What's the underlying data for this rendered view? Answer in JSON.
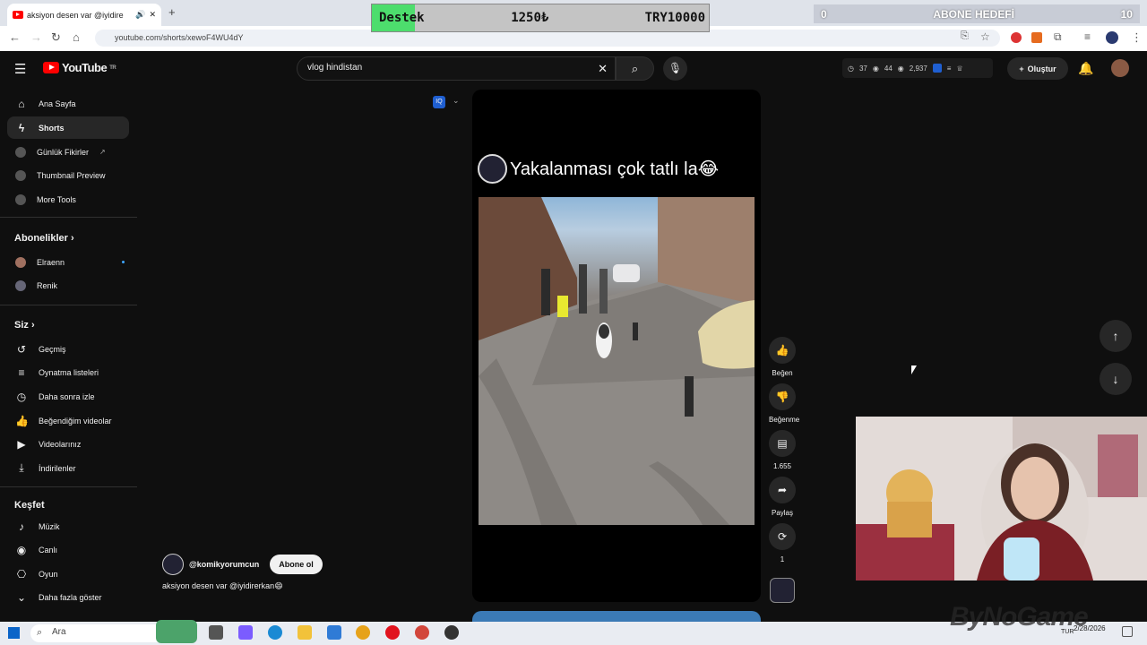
{
  "browser": {
    "tab_title": "aksiyon desen var @iyidire",
    "url": "youtube.com/shorts/xewoF4WU4dY"
  },
  "overlay": {
    "destek_label": "Destek",
    "destek_current": "1250₺",
    "destek_goal": "TRY10000",
    "abone_left": "0",
    "abone_title": "ABONE HEDEFİ",
    "abone_right": "10",
    "watermark": "ByNoGame"
  },
  "youtube": {
    "search_value": "vlog hindistan",
    "stats": {
      "a": "37",
      "b": "44",
      "c": "2,937"
    },
    "create_label": "Oluştur",
    "logo_text": "YouTube",
    "logo_region": "TR"
  },
  "sidebar": {
    "top": [
      {
        "label": "Ana Sayfa",
        "icon": "home-icon"
      },
      {
        "label": "Shorts",
        "icon": "shorts-icon"
      },
      {
        "label": "Günlük Fikirler",
        "icon": "tool-icon"
      },
      {
        "label": "Thumbnail Preview",
        "icon": "tool-icon"
      },
      {
        "label": "More Tools",
        "icon": "tool-icon"
      }
    ],
    "subs_header": "Abonelikler",
    "subs": [
      {
        "label": "Elraenn"
      },
      {
        "label": "Renik"
      }
    ],
    "you_header": "Siz",
    "you": [
      {
        "label": "Geçmiş"
      },
      {
        "label": "Oynatma listeleri"
      },
      {
        "label": "Daha sonra izle"
      },
      {
        "label": "Beğendiğim videolar"
      },
      {
        "label": "Videolarınız"
      },
      {
        "label": "İndirilenler"
      }
    ],
    "explore_header": "Keşfet",
    "explore": [
      {
        "label": "Müzik"
      },
      {
        "label": "Canlı"
      },
      {
        "label": "Oyun"
      },
      {
        "label": "Daha fazla göster"
      }
    ]
  },
  "short": {
    "title": "Yakalanması çok tatlı la😂",
    "channel": "@komikyorumcun",
    "subscribe": "Abone ol",
    "description": "aksiyon desen var @iyidirerkan😄"
  },
  "actions": {
    "like": "Beğen",
    "dislike": "Beğenme",
    "comments": "1.655",
    "share": "Paylaş",
    "remix": "1"
  },
  "taskbar": {
    "search_placeholder": "Ara",
    "lang": "TUR",
    "date": "2/28/2026"
  }
}
